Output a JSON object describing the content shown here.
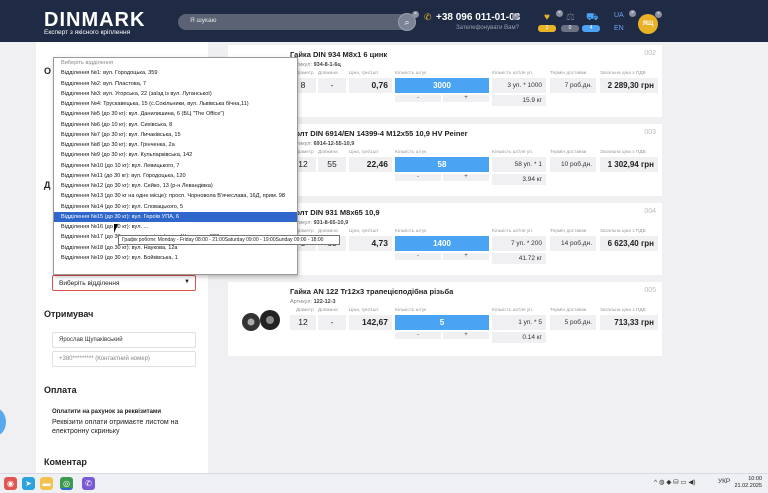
{
  "header": {
    "logo": "DINMARK",
    "tagline": "Експерт з якісного кріплення",
    "search_placeholder": "Я шукаю",
    "phone": "+38 096 011-01-03",
    "callback": "Зателефонувати Вам?",
    "counters": [
      "2",
      "0",
      "4"
    ],
    "lang_ua": "UA",
    "lang_en": "EN",
    "avatar": "ЯЩ"
  },
  "left": {
    "section_o": "О",
    "section_d": "Д",
    "select_value": "Виберіть відділення",
    "recipient_title": "Отримувач",
    "recipient_name": "Ярослав Щупаківський",
    "recipient_phone": "+380********* (Контактний номер)",
    "payment_title": "Оплата",
    "payment_method": "Оплатити на рахунок за реквізитами",
    "payment_note": "Реквізити оплати отримаєте листом на електронну скриньку",
    "comment_title": "Коментар"
  },
  "dropdown": {
    "items": [
      "Виберіть відділення",
      "Відділення №1: вул. Городоцька, 359",
      "Відділення №2: вул. Пластова, 7",
      "Відділення №3: вул. Угорська, 22 (заїзд із вул. Луганської)",
      "Відділення №4: Трускавецька, 15 (с.Сокільники, вул. Львівська бічна,11)",
      "Відділення №5 (до 30 кг): вул. Данилишина, 6 (БЦ \"The Office\")",
      "Відділення №6 (до 10 кг): вул. Сихівська, 8",
      "Відділення №7 (до 30 кг): вул. Личаківська, 15",
      "Відділення №8 (до 30 кг): вул. Грінченка, 2а",
      "Відділення №9 (до 30 кг): вул. Кульпарківська, 142",
      "Відділення №10 (до 10 кг): вул. Левицького, 7",
      "Відділення №11 (до 30 кг): вул. Городоцька, 120",
      "Відділення №12 (до 30 кг): вул. Сейко, 13 (р-н Левандівка)",
      "Відділення №13 (до 30 кг на одне місце): просп. Чорновола В'ячеслава, 16Д, прим. 98",
      "Відділення №14 (до 30 кг): вул. Словацького, 5",
      "Відділення №15 (до 30 кг): вул. Героїв УПА, 6",
      "Відділення №16 (до 30 кг): вул. ...",
      "Відділення №17 (до 30 кг на одне місце): вул. Шевченка, 323",
      "Відділення №18 (до 30 кг): вул. Наукова, 12а",
      "Відділення №19 (до 30 кг): вул. Бойківська, 1"
    ],
    "selected_index": 15,
    "tooltip": "Графік роботи: Monday - Friday 08:00 - 21:00Saturday 09:00 - 19:00Sunday 09:00 - 18:00"
  },
  "columns": {
    "diameter": "Діаметр",
    "length": "Довжина",
    "price": "Ціна, грн/1шт",
    "quantity": "Кількість штук",
    "per_pack": "Кількість шт/ля уп.",
    "delivery": "Термін доставки",
    "total": "Загальна ціна з ПДВ"
  },
  "products": [
    {
      "title": "Гайка DIN 934 M8x1 6 цинк",
      "num": "002",
      "article_label": "Артикул:",
      "article": "934-8-1-6ц",
      "diameter": "8",
      "length": "-",
      "price": "0,76",
      "qty": "3000",
      "packs": "3 уп. * 1000",
      "weight": "15.9 кг",
      "term": "7 роб.дн.",
      "total": "2 289,30 грн"
    },
    {
      "title": "Болт DIN 6914/EN 14399-4 M12x55 10,9 HV Peiner",
      "num": "003",
      "article_label": "Артикул:",
      "article": "6914-12-55-10,9",
      "diameter": "12",
      "length": "55",
      "price": "22,46",
      "qty": "58",
      "packs": "58 уп. * 1",
      "weight": "3.94 кг",
      "term": "10 роб.дн.",
      "total": "1 302,94 грн"
    },
    {
      "title": "Болт DIN 931 M8x65 10,9",
      "num": "004",
      "article_label": "Артикул:",
      "article": "931-8-65-10,9",
      "diameter": "8",
      "length": "65",
      "price": "4,73",
      "qty": "1400",
      "packs": "7 уп. * 200",
      "weight": "41.72 кг",
      "term": "14 роб.дн.",
      "total": "6 623,40 грн"
    },
    {
      "title": "Гайка AN 122 Tr12x3 трапецієподібна різьба",
      "num": "005",
      "article_label": "Артикул:",
      "article": "122-12-3",
      "diameter": "12",
      "length": "-",
      "price": "142,67",
      "qty": "5",
      "packs": "1 уп. * 5",
      "weight": "0.14 кг",
      "term": "5 роб.дн.",
      "total": "713,33 грн"
    }
  ],
  "taskbar": {
    "lang": "УКР",
    "time": "10:00",
    "date": "21.02.2025"
  },
  "colors": {
    "header_bg": "#1f2a44",
    "accent_blue": "#4aa3f3",
    "accent_yellow": "#e9b227",
    "selected": "#2f66cc"
  }
}
